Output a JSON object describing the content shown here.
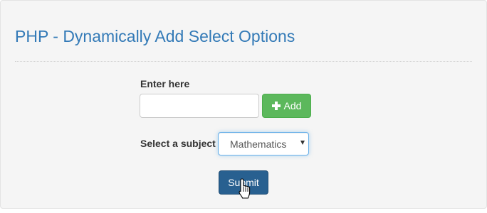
{
  "page": {
    "title": "PHP - Dynamically Add Select Options"
  },
  "form": {
    "enter_label": "Enter here",
    "input_value": "",
    "input_placeholder": "",
    "add_button_label": "Add",
    "add_button_icon": "plus-icon",
    "subject_label": "Select a subject",
    "subject_selected": "Mathematics",
    "submit_label": "Submit"
  },
  "colors": {
    "title": "#337ab7",
    "add_button": "#5cb85c",
    "submit_button": "#286090",
    "panel_background": "#f5f5f5"
  }
}
